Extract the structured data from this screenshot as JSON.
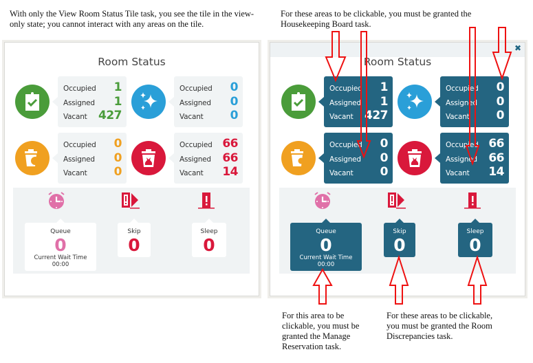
{
  "captions": {
    "left_top": "With only the View Room Status Tile task, you see the tile in the view-only state; you cannot interact with any areas on the tile.",
    "right_top": "For these areas to be clickable, you must be granted the Housekeeping Board task.",
    "bottom_manage": "For this area to be clickable, you must be granted the Manage Reservation task.",
    "bottom_discrepancies": "For these areas to be clickable, you must be granted the Room Discrepancies task."
  },
  "tile": {
    "title": "Room Status",
    "close_icon": "close-icon",
    "row_labels": {
      "occupied": "Occupied",
      "assigned": "Assigned",
      "vacant": "Vacant"
    },
    "groups": [
      {
        "id": "inspected",
        "icon": "clipboard-check-icon",
        "color": "#4a9c3a",
        "occupied": "1",
        "assigned": "1",
        "vacant": "427"
      },
      {
        "id": "clean",
        "icon": "sparkle-icon",
        "color": "#2a9fd8",
        "occupied": "0",
        "assigned": "0",
        "vacant": "0"
      },
      {
        "id": "pickup",
        "icon": "trash-search-icon",
        "color": "#f0a020",
        "occupied": "0",
        "assigned": "0",
        "vacant": "0"
      },
      {
        "id": "dirty",
        "icon": "trash-bag-icon",
        "color": "#d9183b",
        "occupied": "66",
        "assigned": "66",
        "vacant": "14"
      }
    ],
    "bottom": {
      "queue": {
        "label": "Queue",
        "value": "0",
        "wait_label": "Current Wait Time",
        "wait_value": "00:00",
        "icon": "alarm-clock-icon",
        "color": "#e070a8"
      },
      "skip": {
        "label": "Skip",
        "value": "0",
        "icon": "skip-door-icon",
        "color": "#d9183b"
      },
      "sleep": {
        "label": "Sleep",
        "value": "0",
        "icon": "sleep-alert-icon",
        "color": "#d9183b"
      }
    }
  },
  "colors": {
    "active_box": "#246581",
    "annotation_arrow": "#ee1111"
  }
}
